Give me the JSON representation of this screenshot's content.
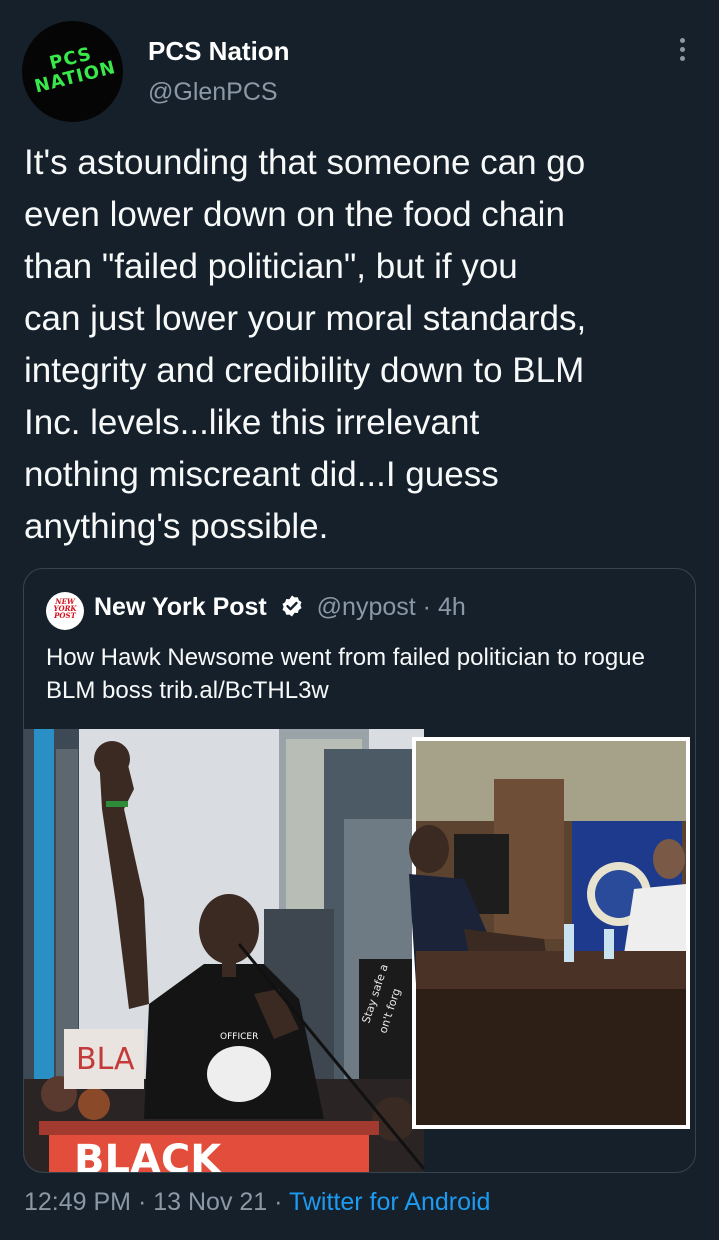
{
  "author": {
    "name": "PCS Nation",
    "handle": "@GlenPCS",
    "avatar_logo": "PCS NATION"
  },
  "icons": {
    "more": "more-vertical-icon",
    "verified": "verified-badge-icon"
  },
  "tweet": {
    "text": "It's astounding that someone can go\neven lower down on the food chain\nthan \"failed politician\", but if you\ncan just lower your moral standards,\nintegrity and credibility down to BLM\nInc. levels...like this irrelevant\nnothing miscreant did...I guess\nanything's possible."
  },
  "quote": {
    "avatar_logo": "NEW YORK POST",
    "name": "New York Post",
    "handle": "@nypost",
    "separator": "·",
    "time": "4h",
    "text": "How Hawk Newsome went from failed politician to rogue BLM boss trib.al/BcTHL3w",
    "image_text": {
      "sign_left": "BLA",
      "protest_sign_1": "Stay safe a",
      "protest_sign_2": "on't forg",
      "shirt_text": "OFFICER",
      "podium": "BLACK"
    }
  },
  "footer": {
    "time": "12:49 PM",
    "sep1": " · ",
    "date": "13 Nov 21",
    "sep2": " · ",
    "app": "Twitter for Android"
  },
  "colors": {
    "background": "#15202b",
    "secondary_text": "#8b98a5",
    "link": "#1d9bf0",
    "border": "#38444d",
    "logo_green": "#39e84a",
    "nypost_red": "#d40f1a"
  }
}
